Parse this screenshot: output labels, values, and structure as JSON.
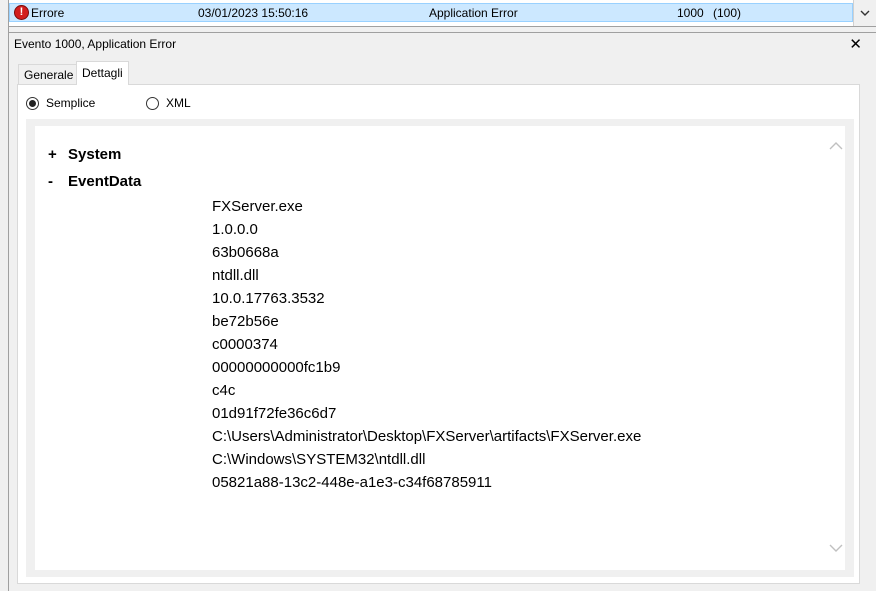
{
  "event_list": {
    "row": {
      "level": "Errore",
      "datetime": "03/01/2023 15:50:16",
      "source": "Application Error",
      "event_id": "1000",
      "task": "(100)"
    }
  },
  "details_pane": {
    "title": "Evento 1000, Application Error",
    "tabs": [
      {
        "label": "Generale",
        "active": false
      },
      {
        "label": "Dettagli",
        "active": true
      }
    ],
    "view_options": [
      {
        "label": "Semplice",
        "selected": true
      },
      {
        "label": "XML",
        "selected": false
      }
    ],
    "tree": {
      "system": {
        "sign": "+",
        "label": "System"
      },
      "event_data": {
        "sign": "-",
        "label": "EventData",
        "values": [
          "FXServer.exe",
          "1.0.0.0",
          "63b0668a",
          "ntdll.dll",
          "10.0.17763.3532",
          "be72b56e",
          "c0000374",
          "00000000000fc1b9",
          "c4c",
          "01d91f72fe36c6d7",
          "C:\\Users\\Administrator\\Desktop\\FXServer\\artifacts\\FXServer.exe",
          "C:\\Windows\\SYSTEM32\\ntdll.dll",
          "05821a88-13c2-448e-a1e3-c34f68785911"
        ]
      }
    }
  },
  "colors": {
    "selection": "#cce8ff",
    "error": "#d21e1e"
  }
}
